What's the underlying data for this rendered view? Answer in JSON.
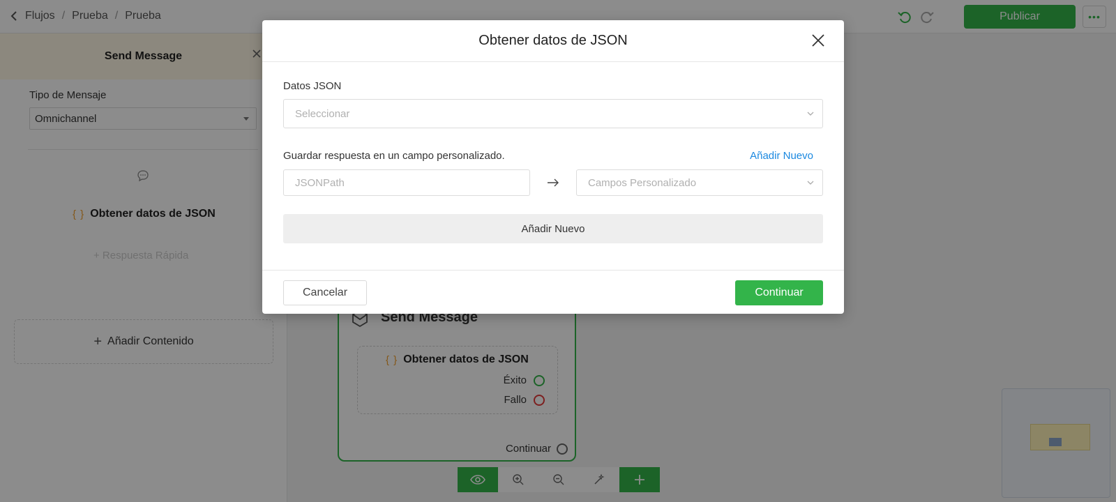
{
  "topbar": {
    "breadcrumb": [
      "Flujos",
      "Prueba",
      "Prueba"
    ],
    "publish_label": "Publicar",
    "more_label": "•••"
  },
  "left_panel": {
    "title": "Send Message",
    "message_type_label": "Tipo de Mensaje",
    "message_type_value": "Omnichannel",
    "json_block_title": "Obtener datos de JSON",
    "quick_reply": "+ Respuesta Rápida",
    "add_content": "Añadir Contenido"
  },
  "canvas": {
    "node_title": "Send Message",
    "inner_title": "Obtener datos de JSON",
    "success_label": "Éxito",
    "fail_label": "Fallo",
    "continue_label": "Continuar"
  },
  "modal": {
    "title": "Obtener datos de JSON",
    "json_data_label": "Datos JSON",
    "json_data_placeholder": "Seleccionar",
    "save_label": "Guardar respuesta en un campo personalizado.",
    "add_new_link": "Añadir Nuevo",
    "jsonpath_placeholder": "JSONPath",
    "custom_fields_placeholder": "Campos Personalizado",
    "add_new_button": "Añadir Nuevo",
    "cancel_label": "Cancelar",
    "continue_label": "Continuar"
  },
  "icons": {
    "brace": "{ }",
    "plus": "+",
    "arrow": "→"
  },
  "colors": {
    "accent_green": "#33b44a",
    "link_blue": "#1a88e0",
    "brace_orange": "#f0a030",
    "fail_red": "#e33a3a"
  }
}
